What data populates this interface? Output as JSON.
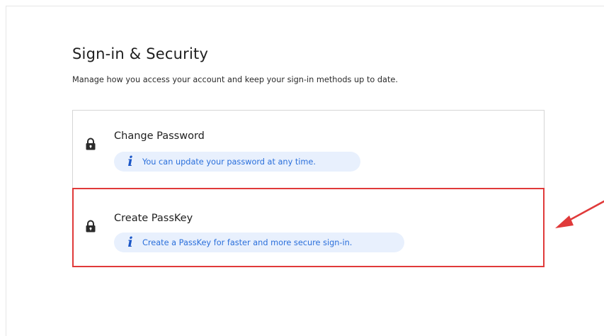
{
  "page": {
    "title": "Sign-in & Security",
    "subtitle": "Manage how you access your account and keep your sign-in methods up to date."
  },
  "options": [
    {
      "title": "Change Password",
      "info": "You can update your password at any time.",
      "icon": "lock-icon"
    },
    {
      "title": "Create PassKey",
      "info": "Create a PassKey for faster and more secure sign-in.",
      "icon": "lock-icon"
    }
  ],
  "info_icon_glyph": "i",
  "colors": {
    "accent_text": "#2a6fdb",
    "info_background": "#e8f0fd",
    "highlight_border": "#e03a3a",
    "arrow": "#e03a3a"
  }
}
